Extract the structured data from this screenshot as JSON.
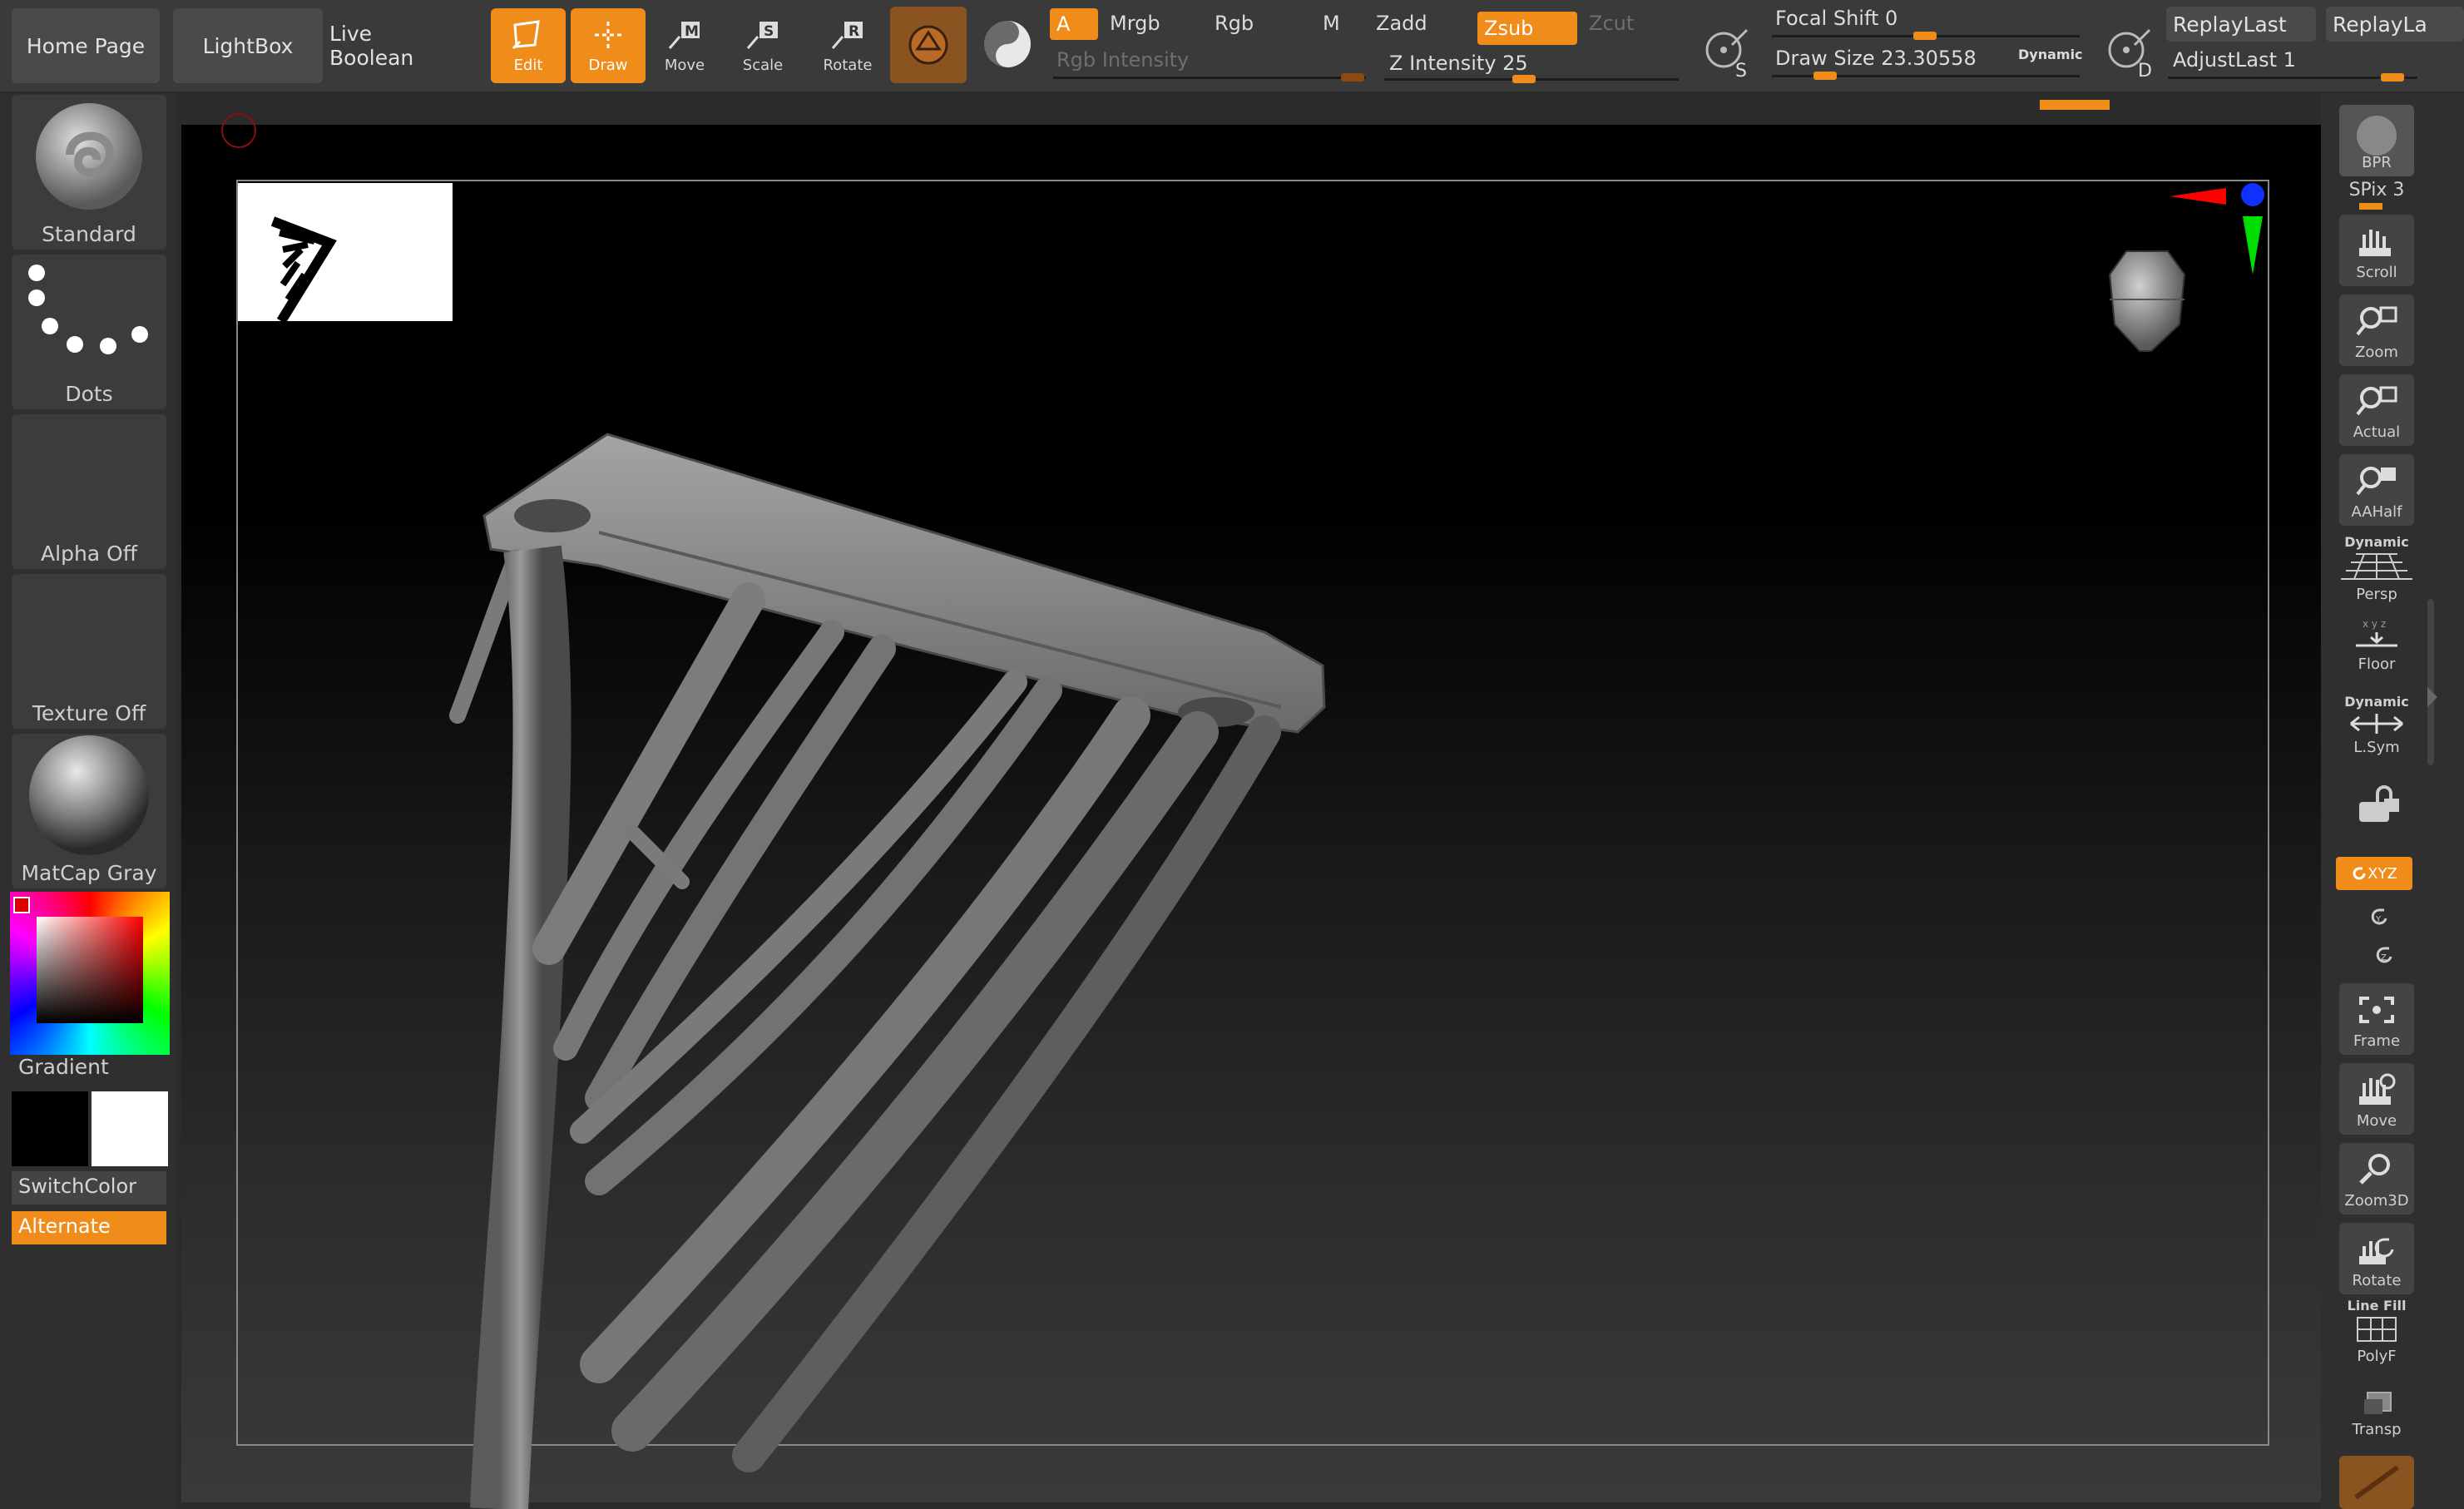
{
  "topbar": {
    "home_page": "Home Page",
    "lightbox": "LightBox",
    "live_boolean": "Live Boolean",
    "tools": [
      "Edit",
      "Draw",
      "Move",
      "Scale",
      "Rotate"
    ],
    "a_label": "A",
    "mrgb": "Mrgb",
    "rgb": "Rgb",
    "m": "M",
    "zadd": "Zadd",
    "zsub": "Zsub",
    "zcut": "Zcut",
    "rgb_intensity": "Rgb Intensity",
    "z_intensity": "Z Intensity 25",
    "focal_shift": "Focal Shift 0",
    "draw_size": "Draw Size 23.30558",
    "dynamic": "Dynamic",
    "s_label": "S",
    "d_label": "D",
    "replay_last": "ReplayLast",
    "replay_last_2": "ReplayLa",
    "adjust_last": "AdjustLast 1"
  },
  "left_shelf": {
    "brush": "Standard",
    "stroke": "Dots",
    "alpha": "Alpha Off",
    "texture": "Texture Off",
    "material": "MatCap Gray",
    "gradient": "Gradient",
    "switch_color": "SwitchColor",
    "alternate": "Alternate"
  },
  "right_shelf": {
    "bpr": "BPR",
    "spix": "SPix 3",
    "scroll": "Scroll",
    "zoom": "Zoom",
    "actual": "Actual",
    "aahalf": "AAHalf",
    "dynamic_persp": "Dynamic",
    "persp": "Persp",
    "floor": "Floor",
    "dynamic_lsym": "Dynamic",
    "lsym": "L.Sym",
    "xyz": "XYZ",
    "frame": "Frame",
    "move": "Move",
    "zoom3d": "Zoom3D",
    "rotate": "Rotate",
    "line_fill": "Line Fill",
    "polyf": "PolyF",
    "transp": "Transp"
  },
  "colors": {
    "accent": "#f08c1a",
    "panel": "#3a3a3a",
    "canvas_top": "#000000",
    "canvas_bottom": "#3a3a3a",
    "mesh": "#8a8a8a"
  }
}
